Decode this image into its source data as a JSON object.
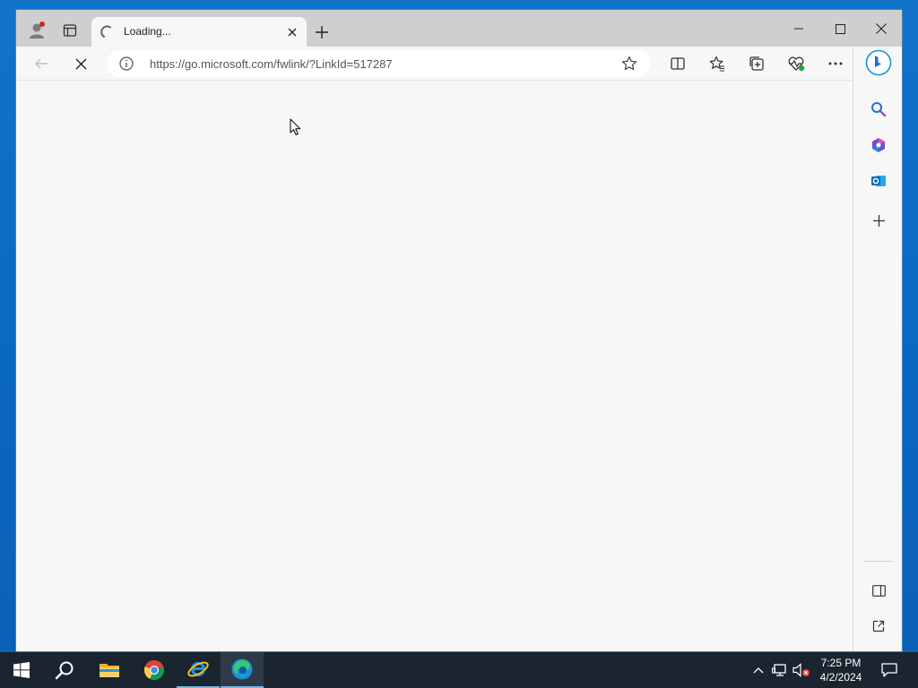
{
  "browser": {
    "tab": {
      "title": "Loading..."
    },
    "address": {
      "url": "https://go.microsoft.com/fwlink/?LinkId=517287"
    }
  },
  "taskbar": {
    "time": "7:25 PM",
    "date": "4/2/2024"
  },
  "colors": {
    "desktop": "#0a67c2",
    "taskbar": "#1a2530",
    "titlebar": "#cfcfcf",
    "window": "#f7f7f7",
    "edge_accent": "#1a8fd6"
  }
}
